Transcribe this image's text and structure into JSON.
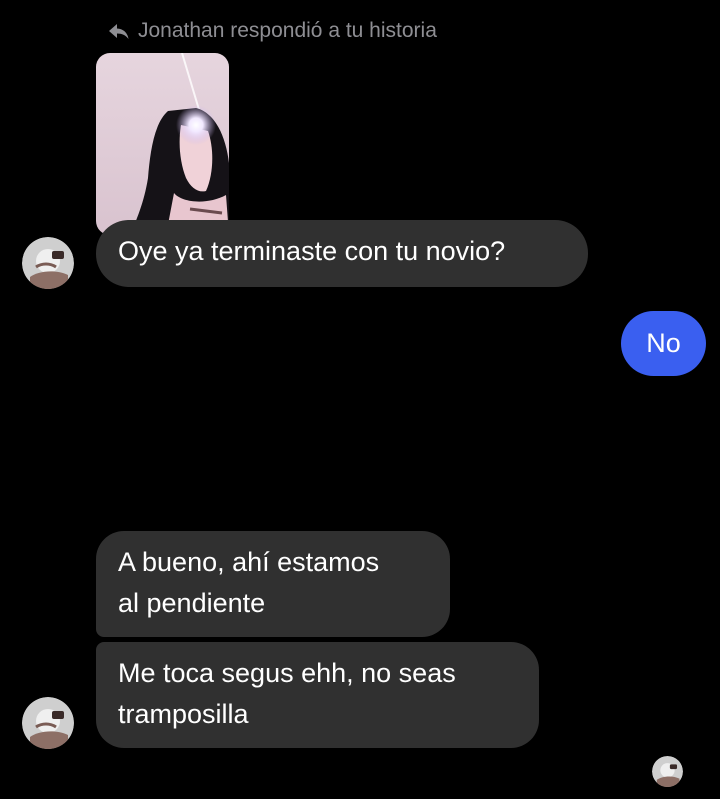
{
  "reply_header": {
    "icon": "reply-arrow-icon",
    "text": "Jonathan respondió a tu historia"
  },
  "story": {
    "icon": "story-thumbnail"
  },
  "messages": [
    {
      "direction": "incoming",
      "lines": [
        "Oye ya terminaste con tu novio?"
      ]
    },
    {
      "direction": "outgoing",
      "lines": [
        "No"
      ]
    },
    {
      "direction": "incoming",
      "lines": [
        "A bueno, ahí estamos",
        "al pendiente"
      ]
    },
    {
      "direction": "incoming",
      "lines": [
        "Me toca segus ehh, no seas",
        "tramposilla"
      ]
    }
  ],
  "colors": {
    "background": "#000000",
    "incoming_bubble": "#303030",
    "outgoing_bubble": "#3a5ff0",
    "meta_text": "#8e8e93"
  }
}
